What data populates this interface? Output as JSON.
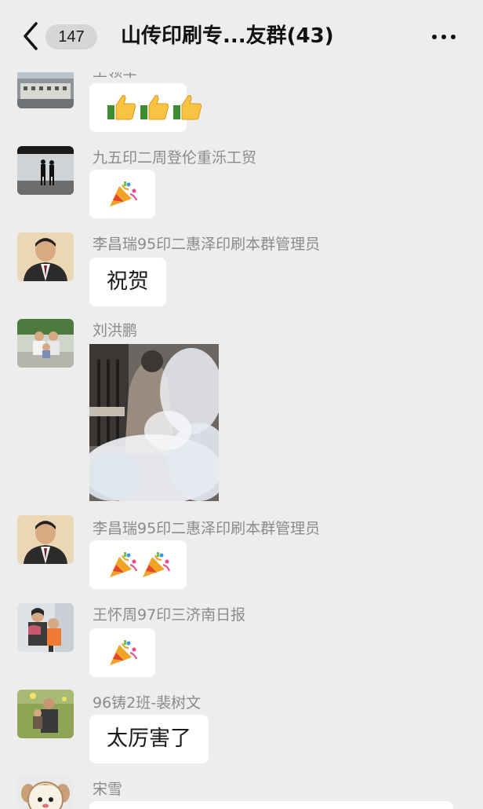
{
  "header": {
    "unread_count": "147",
    "group_title": "山传印刷专...友群(43)",
    "back_icon": "chevron-left-icon",
    "more_icon": "more-dots-icon"
  },
  "messages": [
    {
      "sender": "王领军",
      "content_type": "emoji",
      "content": [
        "thumbs-up",
        "thumbs-up",
        "thumbs-up"
      ]
    },
    {
      "sender": "九五印二周登伦重泺工贸",
      "content_type": "emoji",
      "content": [
        "party-popper"
      ]
    },
    {
      "sender": "李昌瑞95印二惠泽印刷本群管理员",
      "content_type": "text",
      "content": "祝贺"
    },
    {
      "sender": "刘洪鹏",
      "content_type": "image",
      "content": "animated-sticker"
    },
    {
      "sender": "李昌瑞95印二惠泽印刷本群管理员",
      "content_type": "emoji",
      "content": [
        "party-popper",
        "party-popper"
      ]
    },
    {
      "sender": "王怀周97印三济南日报",
      "content_type": "emoji",
      "content": [
        "party-popper"
      ]
    },
    {
      "sender": "96铸2班-裴树文",
      "content_type": "text",
      "content": "太厉害了"
    },
    {
      "sender": "宋雪",
      "content_type": "text",
      "content": ""
    }
  ]
}
